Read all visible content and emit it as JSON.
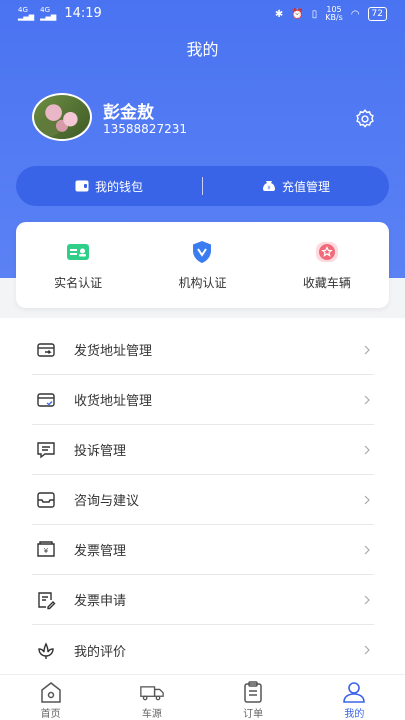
{
  "status": {
    "network1": "4G",
    "network2": "4G",
    "time": "14:19",
    "speed": "105",
    "speed_unit": "KB/s",
    "battery": "72"
  },
  "header": {
    "title": "我的"
  },
  "profile": {
    "name": "彭金敖",
    "phone": "13588827231"
  },
  "wallet": {
    "wallet_label": "我的钱包",
    "recharge_label": "充值管理"
  },
  "quick": [
    {
      "label": "实名认证",
      "color": "#2fcf8a"
    },
    {
      "label": "机构认证",
      "color": "#3b7cf0"
    },
    {
      "label": "收藏车辆",
      "color": "#f06a7a"
    }
  ],
  "menu": [
    {
      "label": "发货地址管理"
    },
    {
      "label": "收货地址管理"
    },
    {
      "label": "投诉管理"
    },
    {
      "label": "咨询与建议"
    },
    {
      "label": "发票管理"
    },
    {
      "label": "发票申请"
    },
    {
      "label": "我的评价"
    }
  ],
  "tabs": [
    {
      "label": "首页"
    },
    {
      "label": "车源"
    },
    {
      "label": "订单"
    },
    {
      "label": "我的"
    }
  ],
  "colors": {
    "primary": "#4a73f2",
    "accent": "#3a64e8"
  }
}
